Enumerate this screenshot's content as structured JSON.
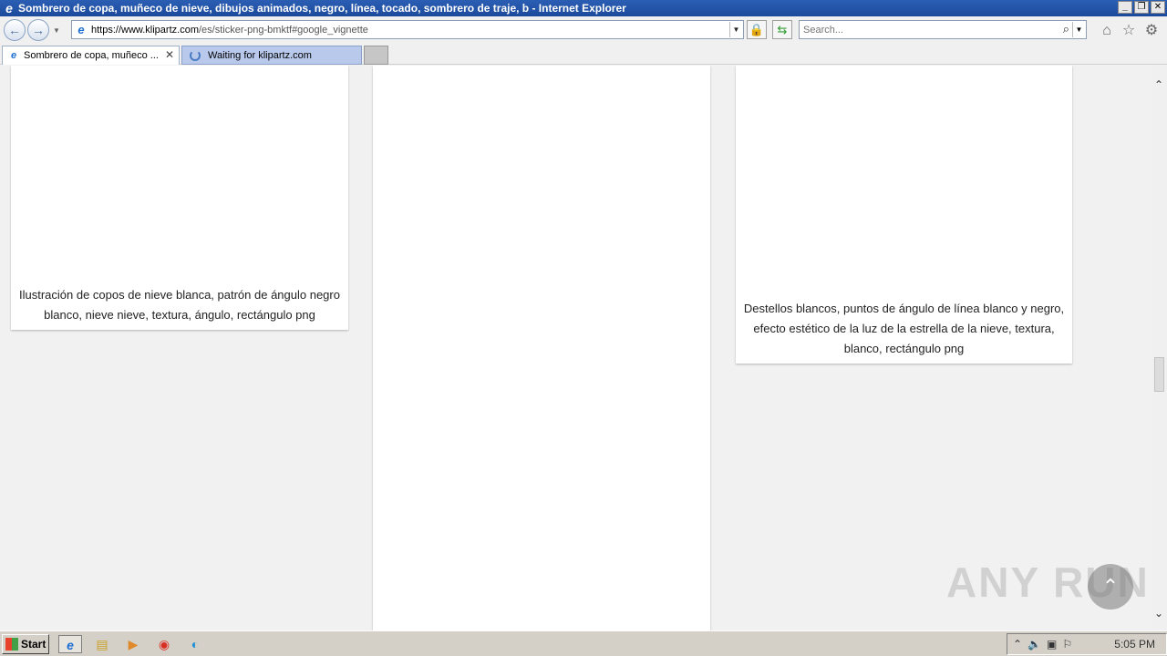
{
  "window": {
    "title": "Sombrero de copa, muñeco de nieve, dibujos animados, negro, línea, tocado, sombrero de traje, b - Internet Explorer",
    "min_label": "_",
    "max_label": "❐",
    "close_label": "✕"
  },
  "nav": {
    "address_prefix": "https://www.",
    "address_domain": "klipartz.com",
    "address_path": "/es/sticker-png-bmktf#google_vignette",
    "search_placeholder": "Search..."
  },
  "tabs": [
    {
      "label": "Sombrero de copa, muñeco ...",
      "active": true
    },
    {
      "label": "Waiting for klipartz.com",
      "active": false
    }
  ],
  "cards": [
    {
      "caption": "Ilustración de copos de nieve blanca, patrón de ángulo negro blanco, nieve nieve, textura, ángulo, rectángulo png"
    },
    {
      "caption": ""
    },
    {
      "caption": "Destellos blancos, puntos de ángulo de línea blanco y negro, efecto estético de la luz de la estrella de la nieve, textura, blanco, rectángulo png"
    }
  ],
  "watermark": "ANY RUN",
  "taskbar": {
    "start_label": "Start",
    "clock": "5:05 PM"
  },
  "icons": {
    "back": "back-arrow-icon",
    "forward": "forward-arrow-icon",
    "home": "home-icon",
    "favorites": "star-icon",
    "settings": "gear-icon"
  }
}
